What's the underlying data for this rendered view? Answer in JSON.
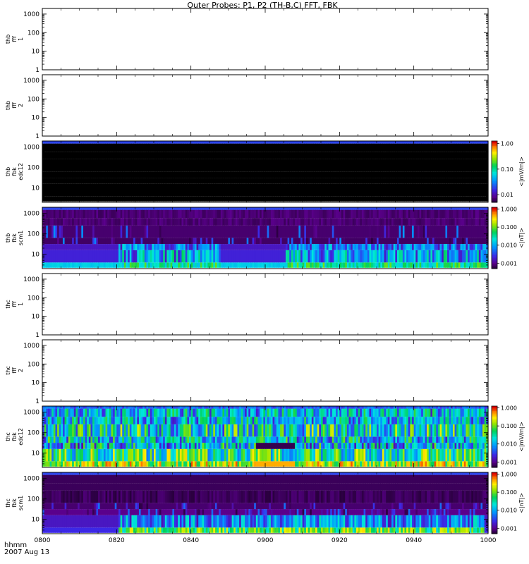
{
  "chart_data": {
    "type": "heatmap",
    "title": "Outer Probes: P1, P2 (TH-B,C) FFT, FBK",
    "x_axis": {
      "ticks": [
        "0800",
        "0820",
        "0840",
        "0900",
        "0920",
        "0940",
        "1000"
      ],
      "label_line1": "hhmm",
      "label_line2": "2007 Aug 13",
      "range_minutes": [
        0,
        120
      ]
    },
    "y_scale": "log",
    "panels": [
      {
        "label": [
          "thb",
          "fff",
          "1"
        ],
        "type": "empty",
        "yticks": [
          "1000",
          "100",
          "10",
          "1"
        ],
        "ylim": [
          1,
          2000
        ]
      },
      {
        "label": [
          "thb",
          "fff",
          "2"
        ],
        "type": "empty",
        "yticks": [
          "1000",
          "100",
          "10",
          "1"
        ],
        "ylim": [
          1,
          2000
        ]
      },
      {
        "label": [
          "thb",
          "fbk",
          "edc12"
        ],
        "type": "spectrogram",
        "yticks": [
          "1000",
          "100",
          "10"
        ],
        "ylim": [
          2,
          2000
        ],
        "colorbar": {
          "label": "<|mV/m|>",
          "ticks": [
            "1.00",
            "0.10",
            "0.01"
          ],
          "log_range": [
            -2.3,
            0.1
          ]
        },
        "pattern": "quiet",
        "seed": 11
      },
      {
        "label": [
          "thb",
          "fbk",
          "scm1"
        ],
        "type": "spectrogram",
        "yticks": [
          "1000",
          "100",
          "10"
        ],
        "ylim": [
          2,
          2000
        ],
        "colorbar": {
          "label": "<|nT|>",
          "ticks": [
            "1.000",
            "0.100",
            "0.010",
            "0.001"
          ],
          "log_range": [
            -3.3,
            0.1
          ]
        },
        "pattern": "scm_b",
        "seed": 23
      },
      {
        "label": [
          "thc",
          "fff",
          "1"
        ],
        "type": "empty",
        "yticks": [
          "1000",
          "100",
          "10",
          "1"
        ],
        "ylim": [
          1,
          2000
        ]
      },
      {
        "label": [
          "thc",
          "fff",
          "2"
        ],
        "type": "empty",
        "yticks": [
          "1000",
          "100",
          "10",
          "1"
        ],
        "ylim": [
          1,
          2000
        ]
      },
      {
        "label": [
          "thc",
          "fbk",
          "edc12"
        ],
        "type": "spectrogram",
        "yticks": [
          "1000",
          "100",
          "10"
        ],
        "ylim": [
          2,
          2000
        ],
        "colorbar": {
          "label": "<|mV/m|>",
          "ticks": [
            "1.000",
            "0.100",
            "0.010",
            "0.001"
          ],
          "log_range": [
            -3.3,
            0.1
          ]
        },
        "pattern": "active",
        "seed": 37
      },
      {
        "label": [
          "thc",
          "fbk",
          "scm1"
        ],
        "type": "spectrogram",
        "yticks": [
          "1000",
          "100",
          "10"
        ],
        "ylim": [
          2,
          2000
        ],
        "colorbar": {
          "label": "<|nT|>",
          "ticks": [
            "1.000",
            "0.100",
            "0.010",
            "0.001"
          ],
          "log_range": [
            -3.3,
            0.1
          ]
        },
        "pattern": "scm_c",
        "seed": 51
      }
    ]
  }
}
